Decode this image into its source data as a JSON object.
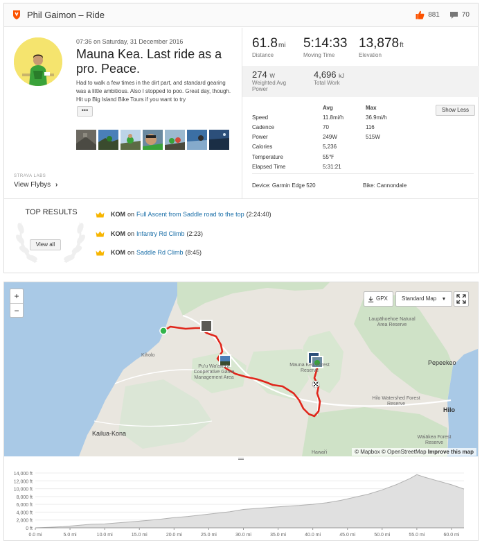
{
  "header": {
    "title": "Phil Gaimon – Ride",
    "kudos_count": "881",
    "comment_count": "70"
  },
  "activity": {
    "date": "07:36 on Saturday, 31 December 2016",
    "name": "Mauna Kea. Last ride as a pro. Peace.",
    "description": "Had to walk a few times in the dirt part, and standard gearing was a little ambitious. Also I stopped to poo. Great day, though. Hit up Big Island Bike Tours if you want to try",
    "more_label": "•••",
    "labs_title": "STRAVA LABS",
    "flybys_label": "View Flybys"
  },
  "stats": {
    "distance": {
      "value": "61.8",
      "unit": "mi",
      "label": "Distance"
    },
    "moving_time": {
      "value": "5:14:33",
      "label": "Moving Time"
    },
    "elevation": {
      "value": "13,878",
      "unit": "ft",
      "label": "Elevation"
    },
    "weighted_power": {
      "value": "274",
      "unit": "W",
      "label": "Weighted Avg Power"
    },
    "total_work": {
      "value": "4,696",
      "unit": "kJ",
      "label": "Total Work"
    }
  },
  "details": {
    "avg_header": "Avg",
    "max_header": "Max",
    "show_less": "Show Less",
    "rows": [
      {
        "name": "Speed",
        "avg": "11.8mi/h",
        "max": "36.9mi/h"
      },
      {
        "name": "Cadence",
        "avg": "70",
        "max": "116"
      },
      {
        "name": "Power",
        "avg": "249W",
        "max": "515W"
      },
      {
        "name": "Calories",
        "avg": "5,236",
        "max": ""
      },
      {
        "name": "Temperature",
        "avg": "55℉",
        "max": ""
      },
      {
        "name": "Elapsed Time",
        "avg": "5:31:21",
        "max": ""
      }
    ],
    "device": "Device: Garmin Edge 520",
    "bike": "Bike: Cannondale"
  },
  "top_results": {
    "title": "TOP RESULTS",
    "view_all": "View all",
    "items": [
      {
        "badge": "KOM",
        "on": "on",
        "segment": "Full Ascent from Saddle road to the top",
        "time": "(2:24:40)"
      },
      {
        "badge": "KOM",
        "on": "on",
        "segment": "Infantry Rd Climb",
        "time": "(2:23)"
      },
      {
        "badge": "KOM",
        "on": "on",
        "segment": "Saddle Rd Climb",
        "time": "(8:45)"
      }
    ]
  },
  "map": {
    "zoom_in": "+",
    "zoom_out": "−",
    "gpx_label": "GPX",
    "style_label": "Standard Map",
    "labels": {
      "kiholo": "Kiholo",
      "puu_waawaa": "Pu'u Wa'awa'a Cooperative Game Management Area",
      "mauna_kea_reserve": "Mauna Kea Forest Reserve",
      "laupahoehoe": "Laupāhoehoe Natural Area Reserve",
      "pepeekeo": "Pepeekeo",
      "hilo_watershed": "Hilo Watershed Forest Reserve",
      "hilo": "Hilo",
      "kailua_kona": "Kailua-Kona",
      "waiakea": "Waiākea Forest Reserve",
      "hawaii": "Hawai'i"
    },
    "attribution": {
      "mapbox": "© Mapbox",
      "osm": "© OpenStreetMap",
      "improve": "Improve this map"
    }
  },
  "chart_data": {
    "type": "area",
    "title": "",
    "xlabel": "",
    "ylabel": "",
    "x_ticks": [
      "0.0 mi",
      "5.0 mi",
      "10.0 mi",
      "15.0 mi",
      "20.0 mi",
      "25.0 mi",
      "30.0 mi",
      "35.0 mi",
      "40.0 mi",
      "45.0 mi",
      "50.0 mi",
      "55.0 mi",
      "60.0 mi"
    ],
    "y_ticks": [
      "0 ft",
      "2,000 ft",
      "4,000 ft",
      "6,000 ft",
      "8,000 ft",
      "10,000 ft",
      "12,000 ft",
      "14,000 ft"
    ],
    "xlim": [
      0,
      61.8
    ],
    "ylim": [
      0,
      14000
    ],
    "x": [
      0,
      2,
      4,
      6,
      8,
      10,
      12,
      15,
      18,
      20,
      22,
      25,
      28,
      30,
      33,
      36,
      38,
      40,
      42,
      44,
      46,
      48,
      50,
      52,
      54,
      55,
      56,
      58,
      60,
      61.8
    ],
    "y": [
      0,
      150,
      300,
      600,
      900,
      1000,
      1300,
      1700,
      2200,
      2600,
      2900,
      3500,
      4100,
      4700,
      5100,
      5500,
      5700,
      6000,
      6400,
      7000,
      7800,
      8600,
      9700,
      11000,
      12600,
      13600,
      13000,
      12000,
      11000,
      9900
    ],
    "fill": "#e0e0e0",
    "line": "#b0b0b0"
  }
}
